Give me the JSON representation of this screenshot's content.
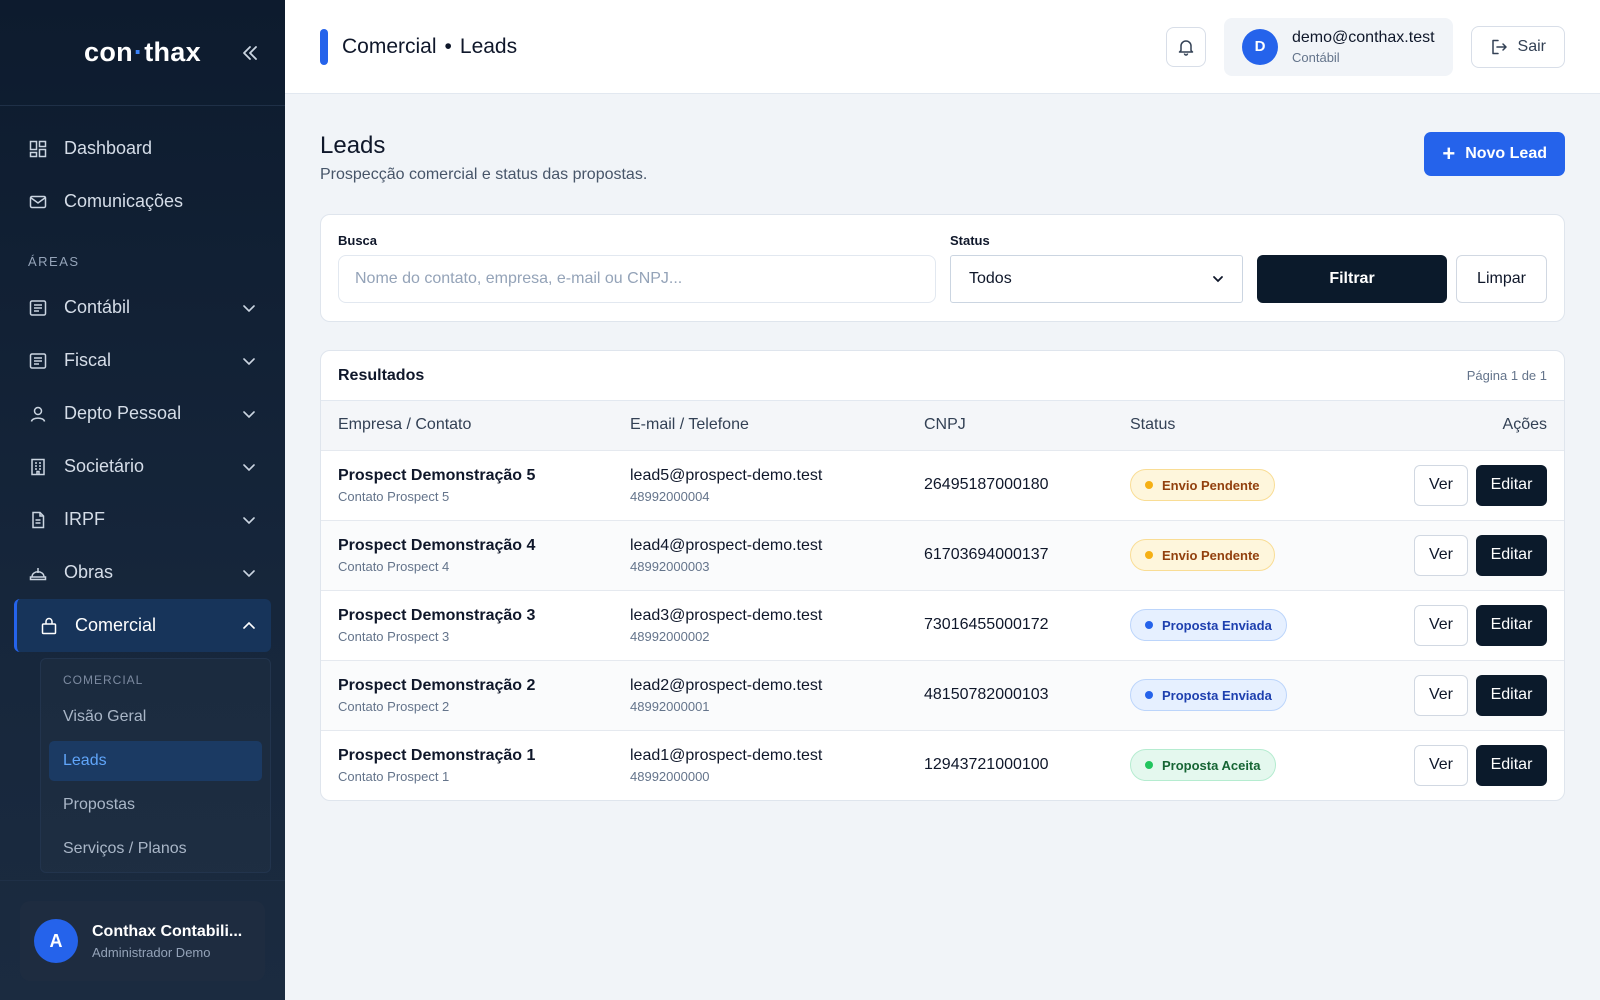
{
  "brand": {
    "name_left": "con",
    "name_dot": "·",
    "name_right": "thax"
  },
  "sidebar": {
    "top_items": [
      {
        "label": "Dashboard",
        "icon": "grid-icon"
      },
      {
        "label": "Comunicações",
        "icon": "mail-icon"
      }
    ],
    "section_label": "ÁREAS",
    "area_items": [
      {
        "label": "Contábil",
        "icon": "ledger-icon"
      },
      {
        "label": "Fiscal",
        "icon": "ledger-icon"
      },
      {
        "label": "Depto Pessoal",
        "icon": "user-icon"
      },
      {
        "label": "Societário",
        "icon": "building-icon"
      },
      {
        "label": "IRPF",
        "icon": "document-icon"
      },
      {
        "label": "Obras",
        "icon": "helmet-icon"
      }
    ],
    "active_item": {
      "label": "Comercial",
      "icon": "bag-icon"
    },
    "submenu": {
      "label": "COMERCIAL",
      "items": [
        "Visão Geral",
        "Leads",
        "Propostas",
        "Serviços / Planos"
      ],
      "active": "Leads"
    },
    "user": {
      "initial": "A",
      "name": "Conthax Contabili...",
      "role": "Administrador Demo"
    }
  },
  "topbar": {
    "breadcrumb_section": "Comercial",
    "breadcrumb_sep": "•",
    "breadcrumb_page": "Leads",
    "account": {
      "initial": "D",
      "email": "demo@conthax.test",
      "area": "Contábil"
    },
    "logout_label": "Sair"
  },
  "page": {
    "title": "Leads",
    "subtitle": "Prospecção comercial e status das propostas.",
    "new_button": "Novo Lead"
  },
  "filters": {
    "search_label": "Busca",
    "search_placeholder": "Nome do contato, empresa, e-mail ou CNPJ...",
    "search_value": "",
    "status_label": "Status",
    "status_value": "Todos",
    "filter_button": "Filtrar",
    "clear_button": "Limpar"
  },
  "results": {
    "title": "Resultados",
    "pager": "Página 1 de 1",
    "columns": [
      "Empresa / Contato",
      "E-mail / Telefone",
      "CNPJ",
      "Status",
      "Ações"
    ],
    "view_label": "Ver",
    "edit_label": "Editar",
    "rows": [
      {
        "company": "Prospect Demonstração 5",
        "contact": "Contato Prospect 5",
        "email": "lead5@prospect-demo.test",
        "phone": "48992000004",
        "cnpj": "26495187000180",
        "status": "Envio Pendente",
        "status_kind": "pending"
      },
      {
        "company": "Prospect Demonstração 4",
        "contact": "Contato Prospect 4",
        "email": "lead4@prospect-demo.test",
        "phone": "48992000003",
        "cnpj": "61703694000137",
        "status": "Envio Pendente",
        "status_kind": "pending"
      },
      {
        "company": "Prospect Demonstração 3",
        "contact": "Contato Prospect 3",
        "email": "lead3@prospect-demo.test",
        "phone": "48992000002",
        "cnpj": "73016455000172",
        "status": "Proposta Enviada",
        "status_kind": "sent"
      },
      {
        "company": "Prospect Demonstração 2",
        "contact": "Contato Prospect 2",
        "email": "lead2@prospect-demo.test",
        "phone": "48992000001",
        "cnpj": "48150782000103",
        "status": "Proposta Enviada",
        "status_kind": "sent"
      },
      {
        "company": "Prospect Demonstração 1",
        "contact": "Contato Prospect 1",
        "email": "lead1@prospect-demo.test",
        "phone": "48992000000",
        "cnpj": "12943721000100",
        "status": "Proposta Aceita",
        "status_kind": "accepted"
      }
    ]
  },
  "colors": {
    "accent": "#2563eb",
    "dark": "#0b1a2b",
    "pending_bg": "#fef6dc",
    "pending_fg": "#92400e",
    "pending_dot": "#f5b014",
    "pending_border": "#f9dd95",
    "sent_bg": "#e6f0ff",
    "sent_fg": "#1e40af",
    "sent_dot": "#2563eb",
    "sent_border": "#bcd5fb",
    "accepted_bg": "#e4f8ee",
    "accepted_fg": "#166534",
    "accepted_dot": "#22c55e",
    "accepted_border": "#b5ecd0"
  }
}
